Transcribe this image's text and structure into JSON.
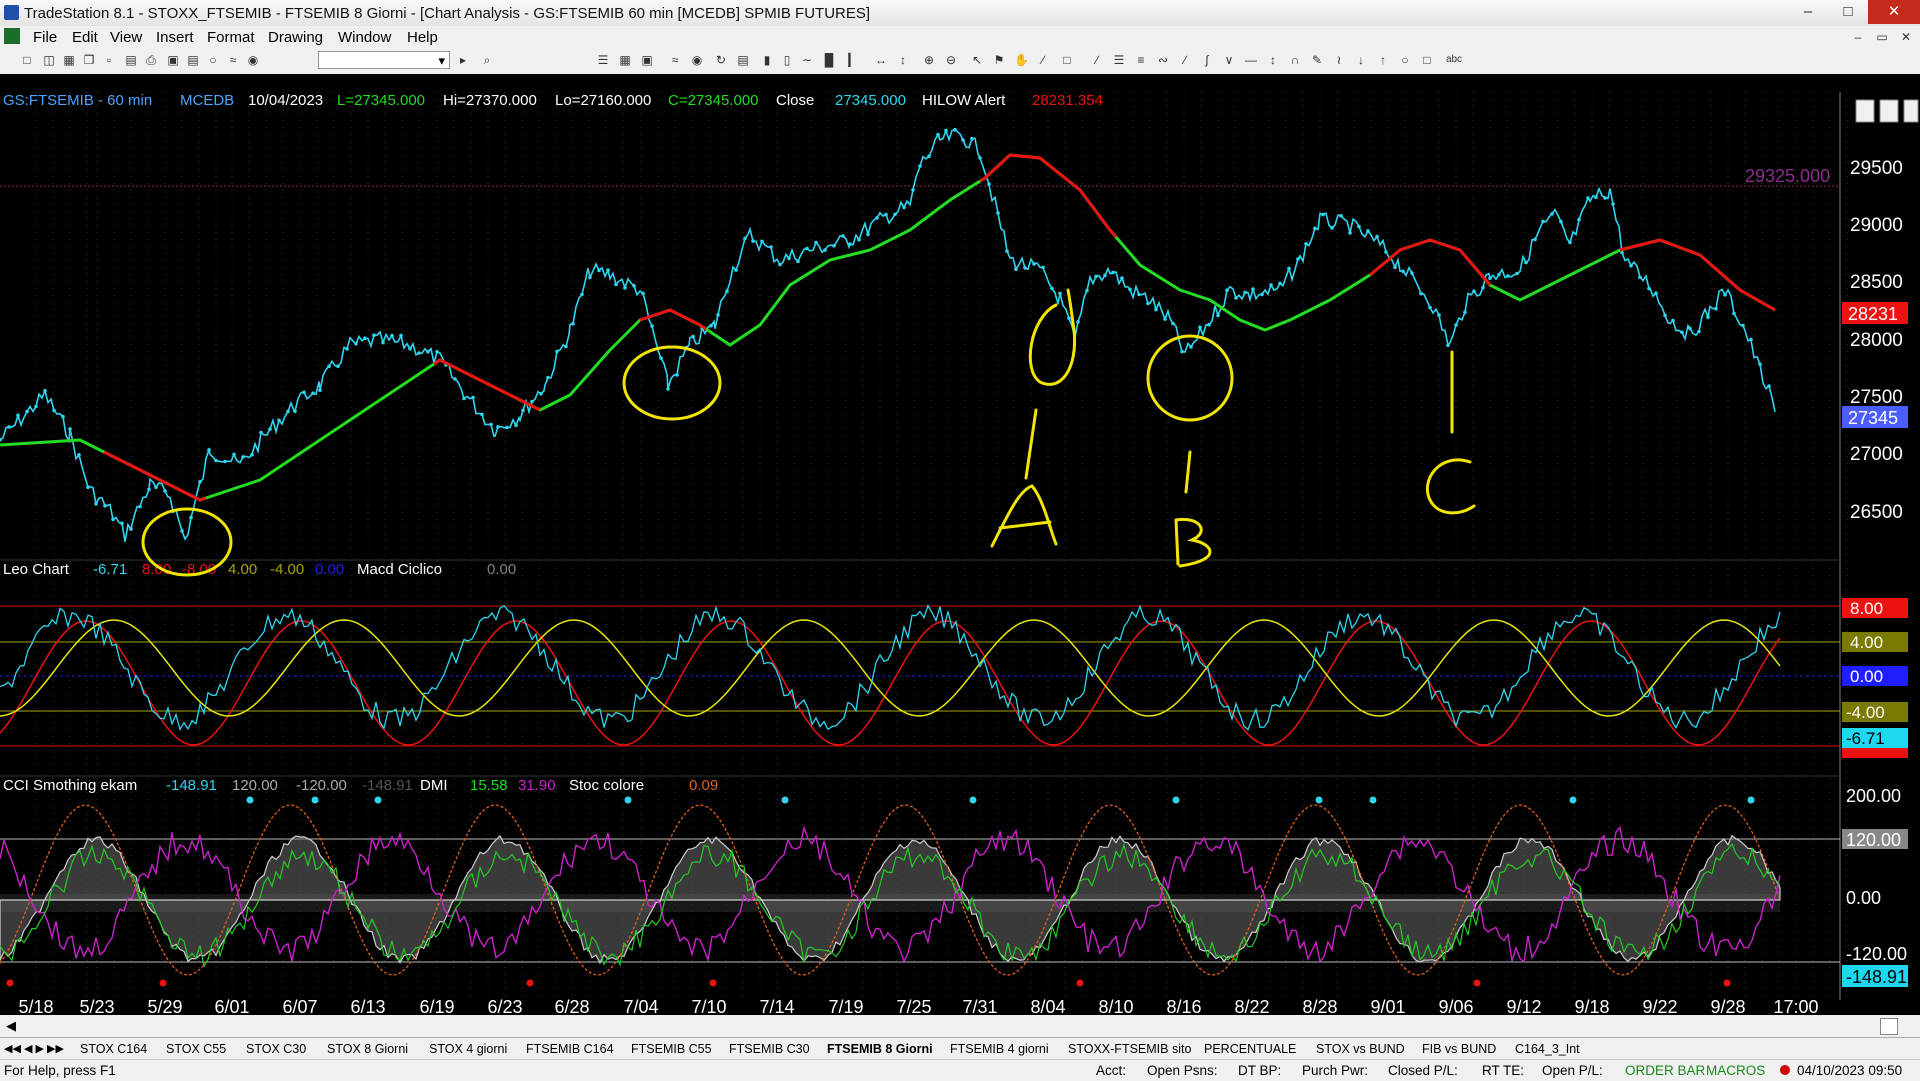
{
  "window": {
    "title": "TradeStation 8.1 - STOXX_FTSEMIB - FTSEMIB  8 Giorni - [Chart Analysis - GS:FTSEMIB  60 min  [MCEDB] SPMIB FUTURES]"
  },
  "menu": [
    "File",
    "Edit",
    "View",
    "Insert",
    "Format",
    "Drawing",
    "Window",
    "Help"
  ],
  "header": {
    "symbol": "GS:FTSEMIB - 60 min",
    "session": "MCEDB",
    "date": "10/04/2023",
    "last": "L=27345.000",
    "hi": "Hi=27370.000",
    "lo": "Lo=27160.000",
    "close": "C=27345.000",
    "close_label": "Close",
    "close_value": "27345.000",
    "alert_label": "HILOW Alert",
    "alert_value": "28231.354"
  },
  "price_axis": {
    "ticks": [
      "29500",
      "29000",
      "28500",
      "28000",
      "27500",
      "27000",
      "26500"
    ],
    "hilow_badge": "28231",
    "last_badge": "27345",
    "level_label": "29325.000"
  },
  "panel2": {
    "name": "Leo Chart",
    "v1": "-6.71",
    "v2": "8.00",
    "v3": "-8.00",
    "v4": "4.00",
    "v5": "-4.00",
    "v6": "0.00",
    "name2": "Macd Ciclico",
    "v7": "0.00",
    "axis": [
      "8.00",
      "4.00",
      "0.00",
      "-4.00",
      "-6.71"
    ]
  },
  "panel3": {
    "name": "CCI Smothing ekam",
    "v1": "-148.91",
    "v2": "120.00",
    "v3": "-120.00",
    "v4": "-148.91",
    "name2": "DMI",
    "v5": "15.58",
    "v6": "31.90",
    "name3": "Stoc colore",
    "v7": "0.09",
    "axis": [
      "200.00",
      "120.00",
      "0.00",
      "-120.00",
      "-148.91"
    ]
  },
  "time_axis": [
    "5/18",
    "5/23",
    "5/29",
    "6/01",
    "6/07",
    "6/13",
    "6/19",
    "6/23",
    "6/28",
    "7/04",
    "7/10",
    "7/14",
    "7/19",
    "7/25",
    "7/31",
    "8/04",
    "8/10",
    "8/16",
    "8/22",
    "8/28",
    "9/01",
    "9/06",
    "9/12",
    "9/18",
    "9/22",
    "9/28",
    "17:00"
  ],
  "annotations": [
    "A",
    "B",
    "C"
  ],
  "tabs": [
    "STOX C164",
    "STOX C55",
    "STOX C30",
    "STOX 8 Giorni",
    "STOX 4 giorni",
    "FTSEMIB C164",
    "FTSEMIB C55",
    "FTSEMIB C30",
    "FTSEMIB 8 Giorni",
    "FTSEMIB 4 giorni",
    "STOXX-FTSEMIB sito",
    "PERCENTUALE",
    "STOX vs BUND",
    "FIB vs BUND",
    "C164_3_Int"
  ],
  "status": {
    "help": "For Help, press F1",
    "acct": "Acct:",
    "open_psns": "Open Psns:",
    "dt_bp": "DT BP:",
    "purch_pwr": "Purch Pwr:",
    "closed_pl": "Closed P/L:",
    "rt_te": "RT TE:",
    "open_pl": "Open P/L:",
    "order_bar": "ORDER BAR",
    "macros": "MACROS",
    "datetime": "04/10/2023 09:50"
  },
  "colors": {
    "price": "#2fd6f0",
    "ma_up": "#22dd22",
    "ma_down": "#ee1111",
    "annotation": "#f2e600",
    "axis_text": "#ffffff"
  }
}
